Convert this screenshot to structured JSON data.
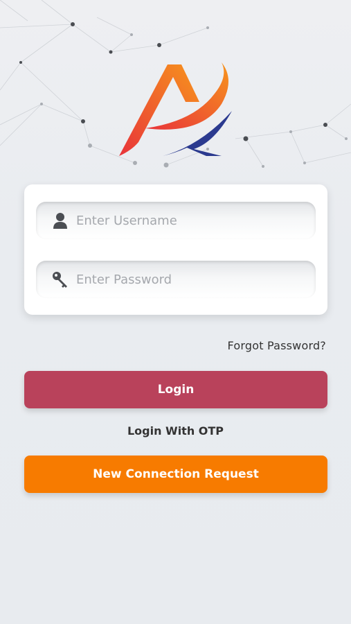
{
  "login_form": {
    "username_placeholder": "Enter Username",
    "password_placeholder": "Enter Password",
    "icons": {
      "username": "user-icon",
      "password": "key-icon"
    }
  },
  "links": {
    "forgot_password": "Forgot Password?",
    "login_with_otp": "Login With OTP"
  },
  "buttons": {
    "login": "Login",
    "new_connection": "New Connection Request"
  },
  "colors": {
    "login_button": "#b9425b",
    "new_connection_button": "#f77b00",
    "logo_orange": "#f58220",
    "logo_red": "#e8343a",
    "logo_navy": "#2b3a8f"
  }
}
